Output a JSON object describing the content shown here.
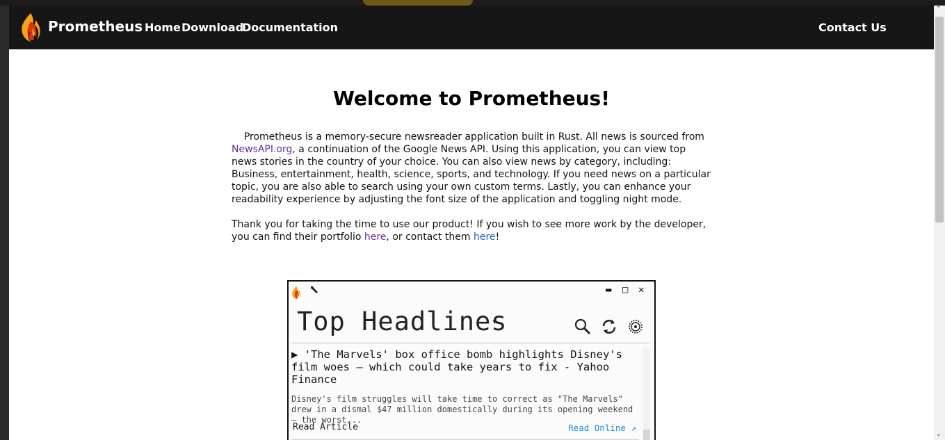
{
  "nav": {
    "brand": "Prometheus",
    "links": [
      "Home",
      "Download",
      "Documentation"
    ],
    "contact": "Contact Us"
  },
  "main": {
    "heading": "Welcome to Prometheus!",
    "intro_line1": "Prometheus is a memory-secure newsreader application built in Rust. All news is sourced from",
    "newsapi_link": "NewsAPI.org",
    "intro_rest": ", a continuation of the Google News API. Using this application, you can view top news stories in the country of your choice. You can also view news by category, including: Business, entertainment, health, science, sports, and technology. If you need news on a particular topic, you are  also able to search using your own custom terms. Lastly, you can enhance your readability experience  by adjusting the font size of the application and toggling night mode.",
    "thanks_text": "Thank you for taking the time to use our product! If you wish to see more work by the developer, you can find their portfolio ",
    "portfolio_link": "here",
    "contact_text": ", or contact them ",
    "contact_link": "here",
    "end_text": "!"
  },
  "app_preview": {
    "title": "Top Headlines",
    "caret": "▾",
    "window_buttons": {
      "minimize": "▬",
      "maximize": "□",
      "close": "✕"
    },
    "icons": [
      "flame-icon",
      "wrench-icon",
      "search-icon",
      "refresh-icon",
      "settings-icon"
    ],
    "article": {
      "expander": "▶",
      "title": "'The Marvels' box office bomb highlights Disney's film woes — which could take years to fix - Yahoo Finance",
      "description": "Disney's film struggles will take time to correct as \"The Marvels\" drew in a dismal $47 million domestically during its opening weekend — the worst...",
      "read_article": "Read Article",
      "read_online": "Read Online ↗"
    }
  },
  "colors": {
    "navbar": "#161616",
    "visited_link": "#6a2ca0",
    "link": "#1e5fc8",
    "app_link": "#1e8de0"
  }
}
